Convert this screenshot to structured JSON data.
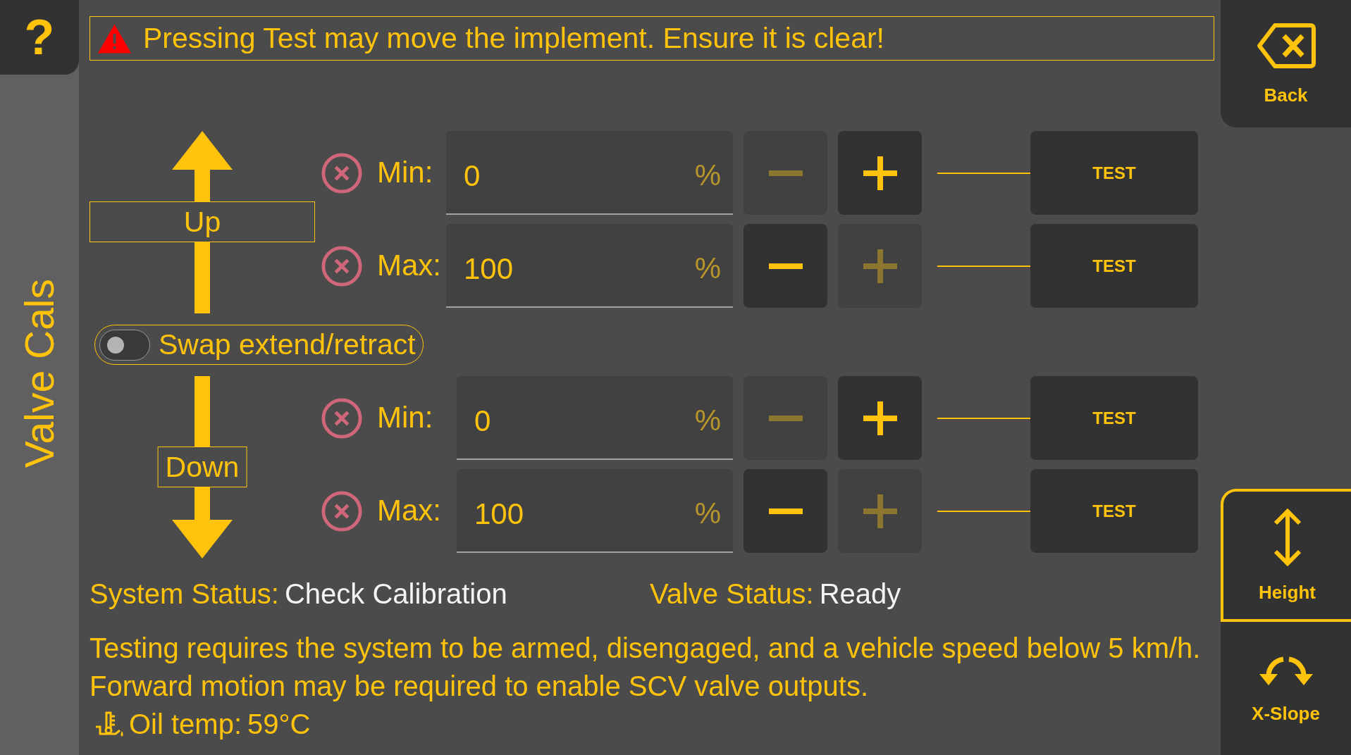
{
  "help_button": {
    "label": "?"
  },
  "page_title": "Valve Cals",
  "warning": {
    "text": "Pressing Test may move the implement. Ensure it is clear!"
  },
  "directions": [
    {
      "kind": "up",
      "label": "Up",
      "limits": [
        {
          "label": "Min:",
          "value": "0",
          "unit": "%",
          "decrease_disabled": true,
          "increase_disabled": false,
          "test_label": "TEST"
        },
        {
          "label": "Max:",
          "value": "100",
          "unit": "%",
          "decrease_disabled": false,
          "increase_disabled": true,
          "test_label": "TEST"
        }
      ]
    },
    {
      "kind": "down",
      "label": "Down",
      "limits": [
        {
          "label": "Min:",
          "value": "0",
          "unit": "%",
          "decrease_disabled": true,
          "increase_disabled": false,
          "test_label": "TEST"
        },
        {
          "label": "Max:",
          "value": "100",
          "unit": "%",
          "decrease_disabled": false,
          "increase_disabled": true,
          "test_label": "TEST"
        }
      ]
    }
  ],
  "swap_toggle": {
    "label": "Swap extend/retract",
    "on": false
  },
  "status": [
    {
      "label": "System Status:",
      "value": "Check Calibration"
    },
    {
      "label": "Valve Status:",
      "value": "Ready"
    }
  ],
  "notes": [
    "Testing requires the system to be armed, disengaged, and a vehicle speed below 5 km/h.",
    "Forward motion may be required to enable SCV valve outputs."
  ],
  "oil_temp": {
    "label": "Oil temp:",
    "value": "59°C"
  },
  "back_button": {
    "label": "Back"
  },
  "modes": [
    {
      "kind": "height",
      "label": "Height",
      "selected": true
    },
    {
      "kind": "x-slope",
      "label": "X-Slope",
      "selected": false
    }
  ]
}
